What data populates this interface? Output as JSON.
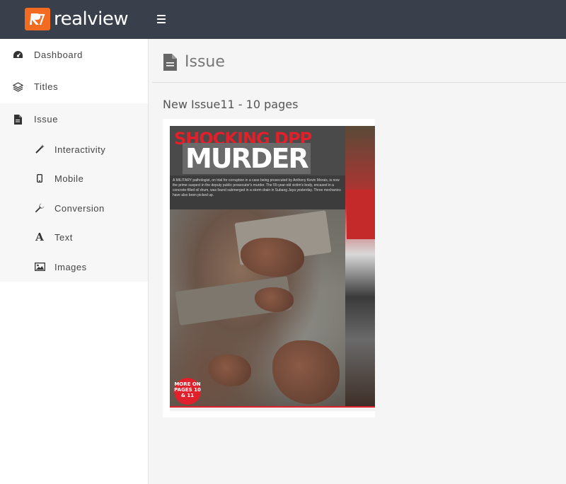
{
  "app": {
    "brand": "realview",
    "brand_color": "#f26b21",
    "topbar_color": "#39404c",
    "menu_icon": "hamburger-icon"
  },
  "sidebar": {
    "items": [
      {
        "label": "Dashboard",
        "icon": "dashboard-icon"
      },
      {
        "label": "Titles",
        "icon": "layers-icon"
      },
      {
        "label": "Issue",
        "icon": "document-icon"
      }
    ],
    "subitems": [
      {
        "label": "Interactivity",
        "icon": "magic-wand-icon"
      },
      {
        "label": "Mobile",
        "icon": "mobile-icon"
      },
      {
        "label": "Conversion",
        "icon": "wrench-icon"
      },
      {
        "label": "Text",
        "icon": "font-icon"
      },
      {
        "label": "Images",
        "icon": "image-icon"
      }
    ]
  },
  "main": {
    "page_title": "Issue",
    "issue_heading": "New Issue11 - 10 pages",
    "cover": {
      "headline_top": "SHOCKING DPP",
      "headline_main": "MURDER",
      "badge": "MORE ON PAGES 10 & 11",
      "body_text": "A MILITARY pathologist, on trial for corruption in a case being prosecuted by Anthony Kevin Morais, is now the prime suspect in the deputy public prosecutor's murder. The 55-year-old victim's body, encased in a concrete-filled oil drum, was found submerged in a storm drain in Subang Jaya yesterday. Three mechanics have also been picked up."
    }
  }
}
